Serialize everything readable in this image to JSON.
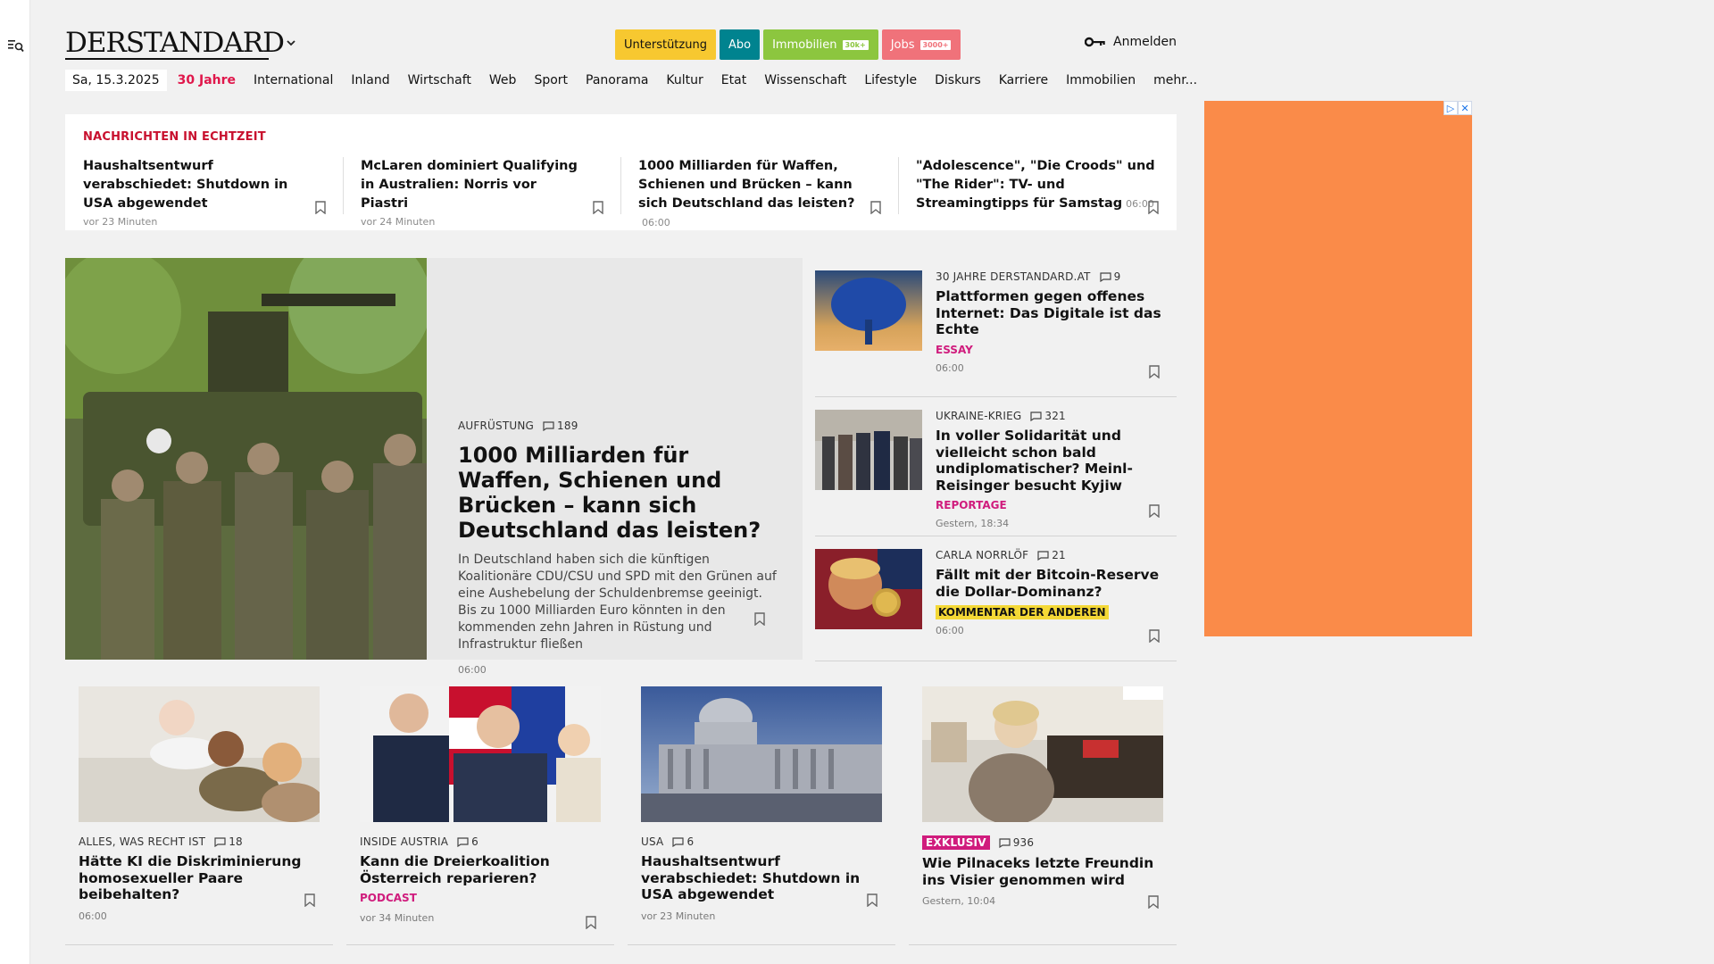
{
  "header": {
    "logo": "DERSTANDARD",
    "pills": [
      {
        "label": "Unterstützung",
        "bg": "#f7c830",
        "fg": "#121212",
        "badge": ""
      },
      {
        "label": "Abo",
        "bg": "#00838f",
        "fg": "#ffffff",
        "badge": ""
      },
      {
        "label": "Immobilien",
        "bg": "#8cc63f",
        "fg": "#ffffff",
        "badge": "30k+"
      },
      {
        "label": "Jobs",
        "bg": "#f0727a",
        "fg": "#ffffff",
        "badge": "3000+"
      }
    ],
    "login_label": "Anmelden"
  },
  "nav": {
    "date": "Sa, 15.3.2025",
    "items": [
      "30 Jahre",
      "International",
      "Inland",
      "Wirtschaft",
      "Web",
      "Sport",
      "Panorama",
      "Kultur",
      "Etat",
      "Wissenschaft",
      "Lifestyle",
      "Diskurs",
      "Karriere",
      "Immobilien",
      "mehr..."
    ]
  },
  "ticker": {
    "title": "NACHRICHTEN IN ECHTZEIT",
    "items": [
      {
        "headline": "Haushaltsentwurf verabschiedet: Shutdown in USA abgewendet",
        "time": "",
        "ago": "vor 23 Minuten"
      },
      {
        "headline": "McLaren dominiert Qualifying in Australien: Norris vor Piastri",
        "time": "",
        "ago": "vor 24 Minuten"
      },
      {
        "headline": "1000 Milliarden für Waffen, Schienen und Brücken – kann sich Deutschland das leisten?",
        "time": "06:00",
        "ago": ""
      },
      {
        "headline": "\"Adolescence\", \"Die Croods\" und \"The Rider\": TV- und Streamingtipps für Samstag",
        "time": "06:00",
        "ago": ""
      }
    ]
  },
  "lead": {
    "kicker": "AUFRÜSTUNG",
    "comments": "189",
    "title": "1000 Milliarden für Waffen, Schienen und Brücken – kann sich Deutschland das leisten?",
    "text": "In Deutschland haben sich die künftigen Koalitionäre CDU/CSU und SPD mit den Grünen auf eine Aushebelung der Schuldenbremse geeinigt. Bis zu 1000 Milliarden Euro könnten in den kommenden zehn Jahren in Rüstung und Infrastruktur fließen",
    "time": "06:00"
  },
  "side": [
    {
      "kicker": "30 JAHRE DERSTANDARD.AT",
      "comments": "9",
      "title": "Plattformen gegen offenes Internet: Das Digitale ist das Echte",
      "tag": "ESSAY",
      "time": "06:00"
    },
    {
      "kicker": "UKRAINE-KRIEG",
      "comments": "321",
      "title": "In voller Solidarität und vielleicht schon bald undiplomatischer? Meinl-Reisinger besucht Kyjiw",
      "tag": "REPORTAGE",
      "time": "Gestern, 18:34"
    },
    {
      "kicker": "CARLA NORRLÖF",
      "comments": "21",
      "title": "Fällt mit der Bitcoin-Reserve die Dollar-Dominanz?",
      "tag": "KOMMENTAR DER ANDEREN",
      "time": "06:00"
    }
  ],
  "cards": [
    {
      "kicker": "ALLES, WAS RECHT IST",
      "comments": "18",
      "title": "Hätte KI die Diskriminierung homosexueller Paare beibehalten?",
      "tag": "",
      "time": "06:00"
    },
    {
      "kicker": "INSIDE AUSTRIA",
      "comments": "6",
      "title": "Kann die Dreierkoalition Österreich reparieren?",
      "tag": "PODCAST",
      "time": "vor 34 Minuten"
    },
    {
      "kicker": "USA",
      "comments": "6",
      "title": "Haushaltsentwurf verabschiedet: Shutdown in USA abgewendet",
      "tag": "",
      "time": "vor 23 Minuten"
    },
    {
      "kicker": "EXKLUSIV",
      "comments": "936",
      "title": "Wie Pilnaceks letzte Freundin ins Visier genommen wird",
      "tag": "",
      "time": "Gestern, 10:04"
    }
  ],
  "colors": {
    "accent": "#e0174b",
    "ticker_title": "#c8102e",
    "tag_pink": "#d01c7d",
    "ad_bg": "#fa8b49"
  }
}
